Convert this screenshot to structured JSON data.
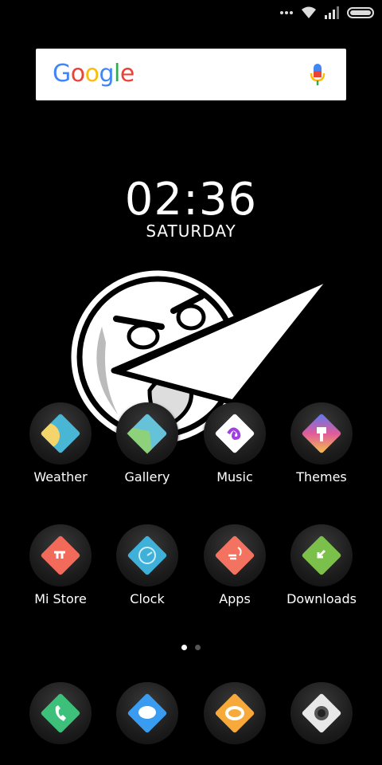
{
  "search": {
    "logo_text": [
      "G",
      "o",
      "o",
      "g",
      "l",
      "e"
    ],
    "logo_colors": [
      "#4285F4",
      "#EA4335",
      "#FBBC05",
      "#4285F4",
      "#34A853",
      "#EA4335"
    ]
  },
  "clock": {
    "time": "02:36",
    "day": "SATURDAY"
  },
  "apps_row1": [
    {
      "label": "Weather",
      "icon": "weather-icon"
    },
    {
      "label": "Gallery",
      "icon": "gallery-icon"
    },
    {
      "label": "Music",
      "icon": "music-icon"
    },
    {
      "label": "Themes",
      "icon": "themes-icon"
    }
  ],
  "apps_row2": [
    {
      "label": "Mi Store",
      "icon": "mi-store-icon"
    },
    {
      "label": "Clock",
      "icon": "clock-icon"
    },
    {
      "label": "Apps",
      "icon": "apps-icon"
    },
    {
      "label": "Downloads",
      "icon": "downloads-icon"
    }
  ],
  "dock": [
    {
      "icon": "phone-icon"
    },
    {
      "icon": "messaging-icon"
    },
    {
      "icon": "browser-icon"
    },
    {
      "icon": "camera-icon"
    }
  ],
  "page_indicator": {
    "pages": 2,
    "current": 1
  }
}
